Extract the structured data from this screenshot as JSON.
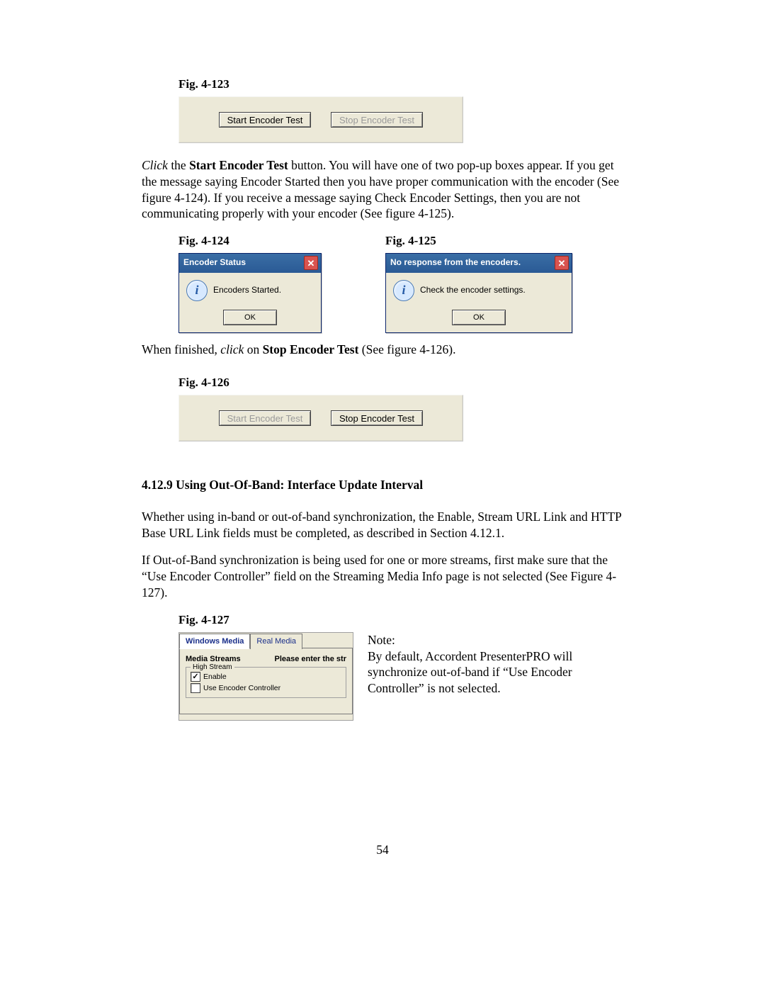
{
  "fig123": {
    "label": "Fig. 4-123",
    "btn_start": "Start Encoder Test",
    "btn_stop": "Stop Encoder Test"
  },
  "para1": {
    "click": "Click",
    "the": " the ",
    "btn": "Start Encoder Test",
    "rest": " button. You will have one of two pop-up boxes appear. If you get the message saying Encoder Started then you have proper communication with the encoder (See figure 4-124). If you receive a message saying Check Encoder Settings, then you are not communicating properly with your encoder (See figure 4-125)."
  },
  "fig124": {
    "label": "Fig. 4-124",
    "title": "Encoder Status",
    "msg": "Encoders Started.",
    "ok": "OK"
  },
  "fig125": {
    "label": "Fig. 4-125",
    "title": "No response from the encoders.",
    "msg": "Check the encoder settings.",
    "ok": "OK"
  },
  "para2": {
    "a": "When finished, ",
    "click": "click",
    "b": " on ",
    "stop": "Stop Encoder Test",
    "c": " (See figure 4-126)."
  },
  "fig126": {
    "label": "Fig. 4-126",
    "btn_start": "Start Encoder Test",
    "btn_stop": "Stop Encoder Test"
  },
  "section": "4.12.9 Using Out-Of-Band:  Interface Update Interval",
  "para3": "Whether using in-band or out-of-band synchronization, the Enable, Stream URL Link and HTTP Base URL Link fields must be completed, as described in Section 4.12.1.",
  "para4": "If Out-of-Band synchronization is being used for one or more streams, first make sure that the “Use Encoder Controller” field on the Streaming Media Info page is not selected (See Figure 4-127).",
  "fig127": {
    "label": "Fig. 4-127",
    "tab1": "Windows Media",
    "tab2": "Real Media",
    "media_streams": "Media Streams",
    "prompt": "Please enter the str",
    "group": "High Stream",
    "enable": "Enable",
    "use_enc": "Use Encoder Controller",
    "check": "✓",
    "note_label": "Note:",
    "note_text": "By default, Accordent PresenterPRO will synchronize out-of-band if “Use Encoder Controller” is not selected."
  },
  "page_number": "54"
}
